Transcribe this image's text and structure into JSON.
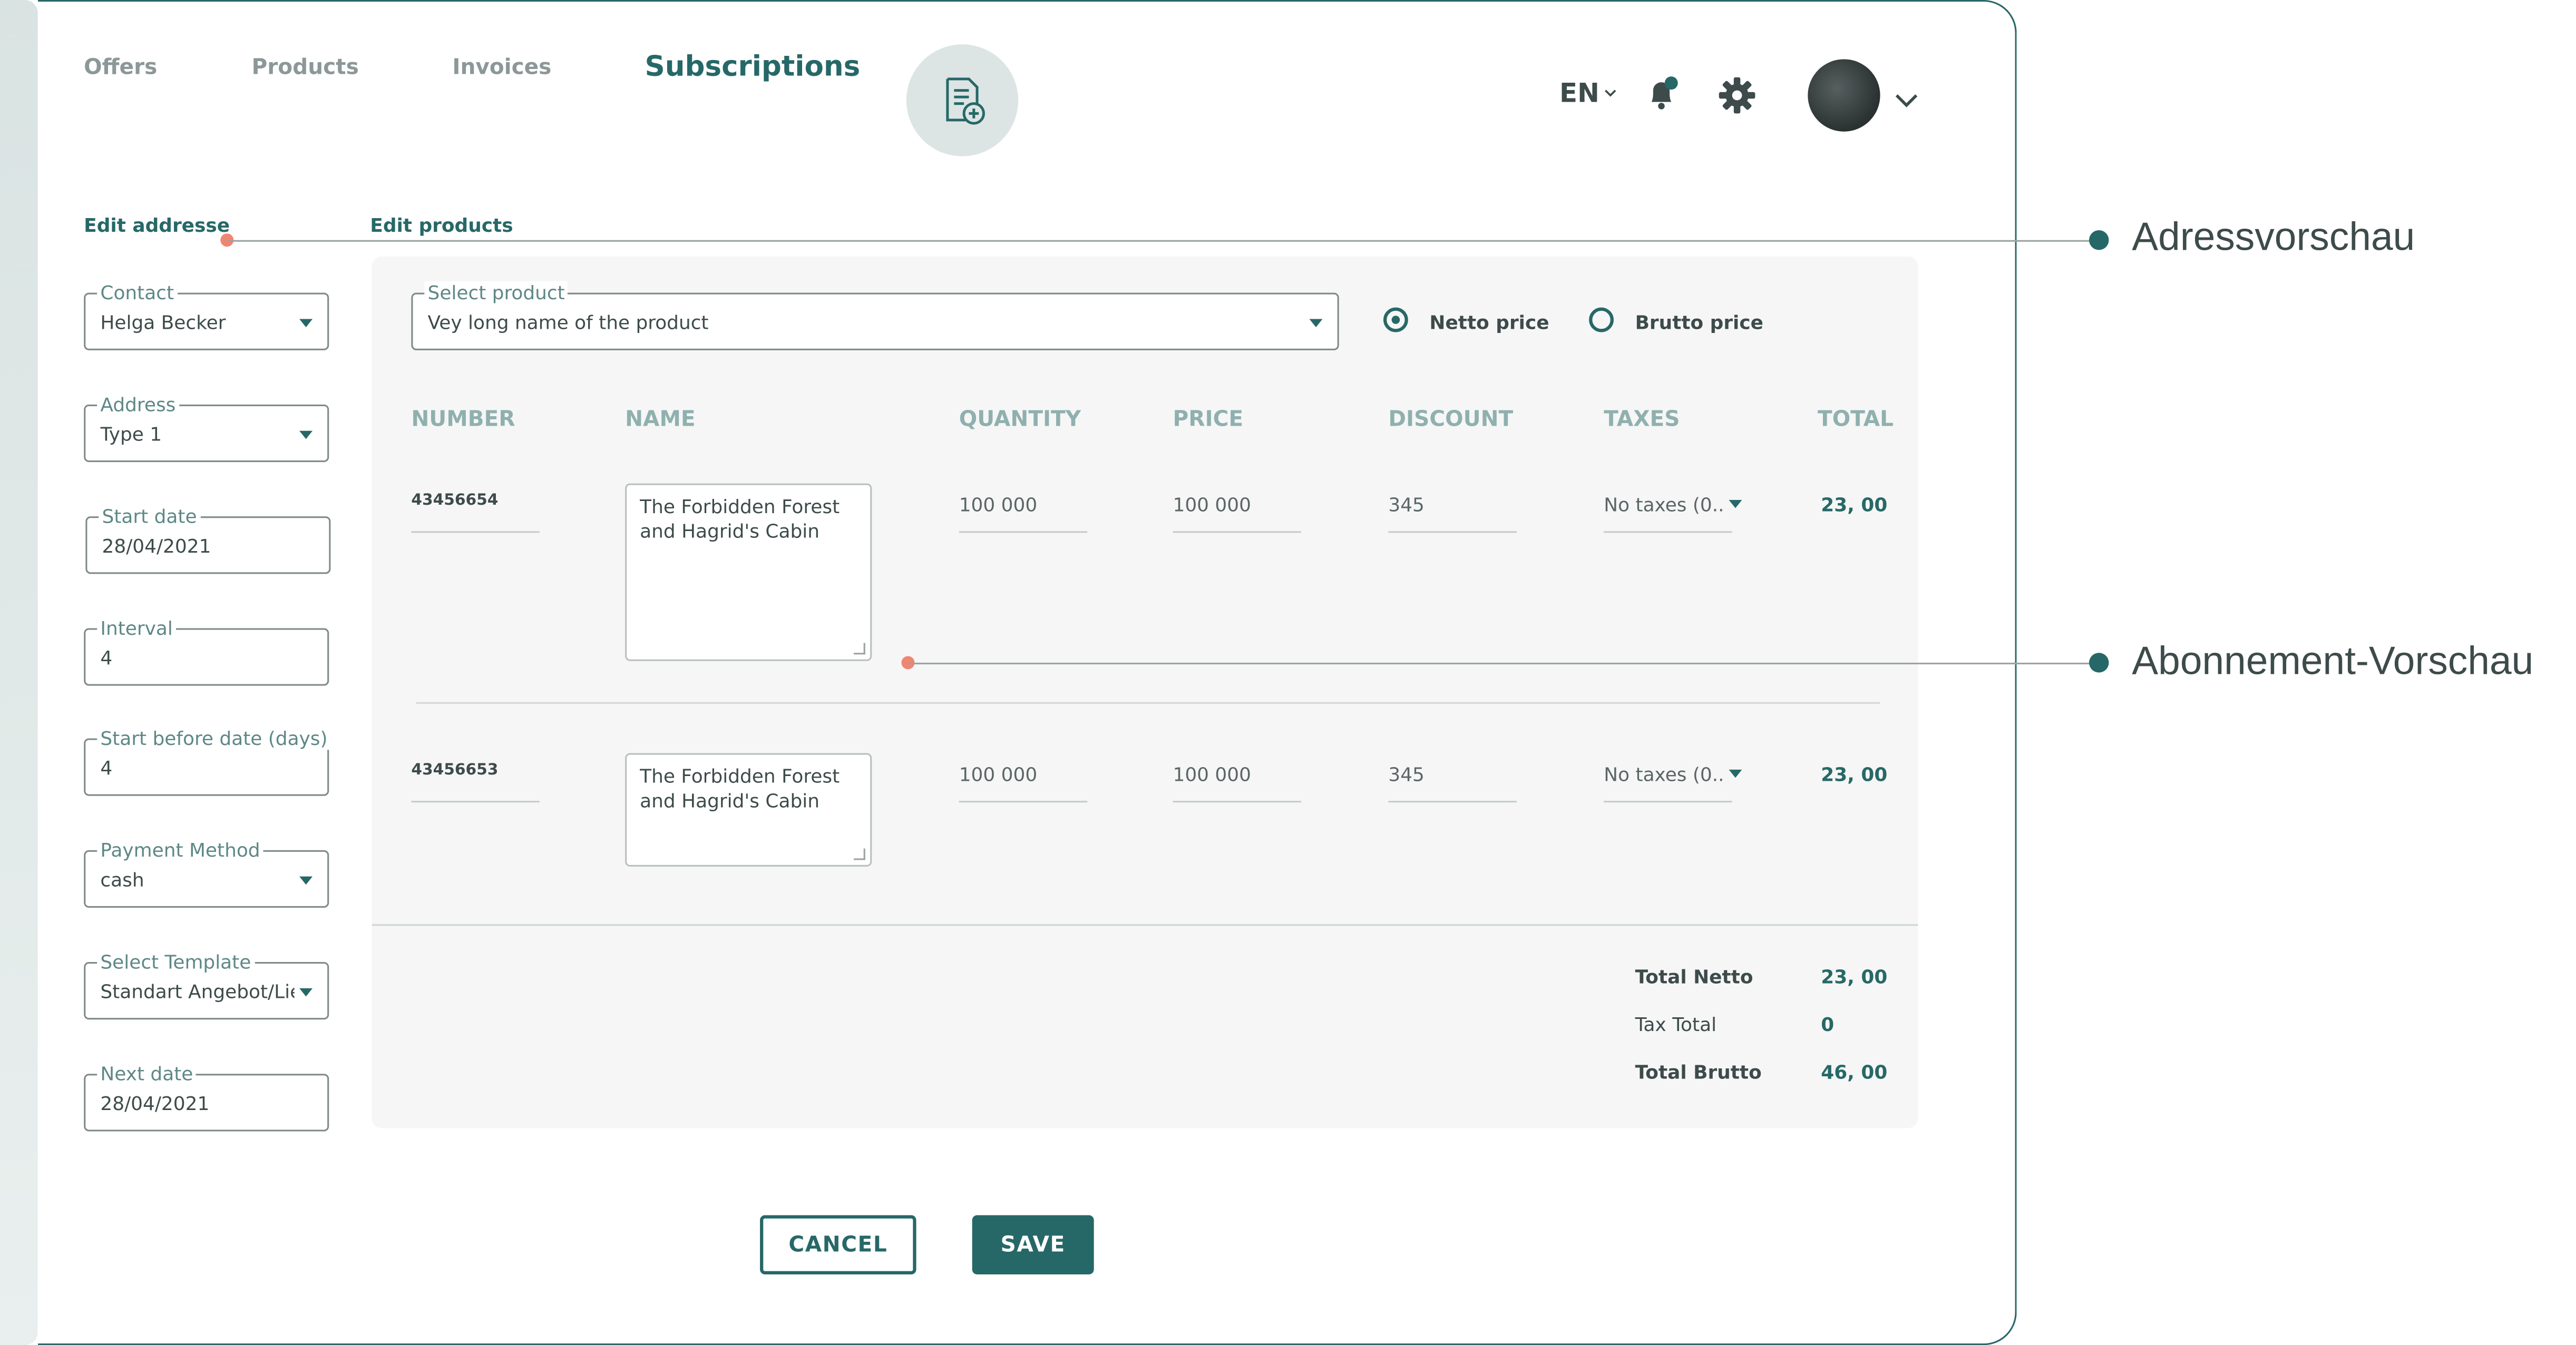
{
  "nav": {
    "offers": "Offers",
    "products": "Products",
    "invoices": "Invoices",
    "subscriptions": "Subscriptions"
  },
  "header": {
    "language": "EN"
  },
  "sections": {
    "edit_address": "Edit addresse",
    "edit_products": "Edit products"
  },
  "form": {
    "contact": {
      "label": "Contact",
      "value": "Helga Becker"
    },
    "address": {
      "label": "Address",
      "value": "Type 1"
    },
    "start_date": {
      "label": "Start date",
      "value": "28/04/2021"
    },
    "interval": {
      "label": "Interval",
      "value": "4"
    },
    "start_before": {
      "label": "Start before date (days)",
      "value": "4"
    },
    "payment_method": {
      "label": "Payment Method",
      "value": "cash"
    },
    "template": {
      "label": "Select Template",
      "value": "Standart Angebot/Lie"
    },
    "next_date": {
      "label": "Next date",
      "value": "28/04/2021"
    }
  },
  "products": {
    "select_label": "Select product",
    "select_value": "Vey long name of the product",
    "price_mode": {
      "netto": "Netto price",
      "brutto": "Brutto price",
      "selected": "netto"
    },
    "columns": [
      "NUMBER",
      "NAME",
      "QUANTITY",
      "PRICE",
      "DISCOUNT",
      "TAXES",
      "TOTAL"
    ],
    "rows": [
      {
        "number": "43456654",
        "name": "The Forbidden Forest and Hagrid's Cabin",
        "quantity": "100 000",
        "price": "100 000",
        "discount": "345",
        "taxes": "No taxes (0..",
        "total": "23, 00"
      },
      {
        "number": "43456653",
        "name": "The Forbidden Forest and Hagrid's Cabin",
        "quantity": "100 000",
        "price": "100 000",
        "discount": "345",
        "taxes": "No taxes (0..",
        "total": "23, 00"
      }
    ],
    "totals": {
      "netto_label": "Total Netto",
      "netto_value": "23, 00",
      "tax_label": "Tax Total",
      "tax_value": "0",
      "brutto_label": "Total Brutto",
      "brutto_value": "46, 00"
    }
  },
  "actions": {
    "cancel": "CANCEL",
    "save": "SAVE"
  },
  "callouts": {
    "address_preview": "Adressvorschau",
    "subscription_preview": "Abonnement-Vorschau"
  },
  "colors": {
    "accent": "#266867",
    "pin": "#f08572",
    "card_bg": "#f6f6f6"
  }
}
